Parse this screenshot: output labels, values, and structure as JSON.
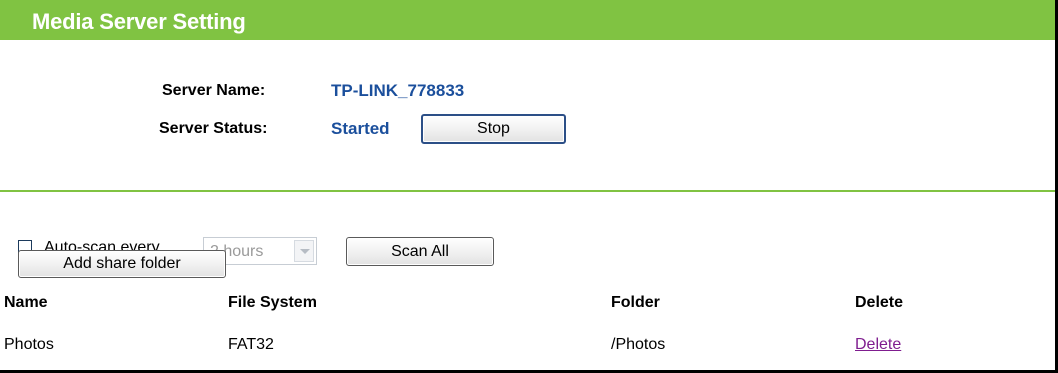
{
  "header": {
    "title": "Media Server Setting"
  },
  "server": {
    "name_label": "Server Name:",
    "name_value": "TP-LINK_778833",
    "status_label": "Server Status:",
    "status_value": "Started",
    "stop_label": "Stop"
  },
  "scan": {
    "auto_scan_checked": false,
    "auto_scan_label": "Auto-scan every",
    "interval_value": "2 hours",
    "scan_all_label": "Scan All",
    "add_folder_label": "Add share folder"
  },
  "table": {
    "columns": [
      "Name",
      "File System",
      "Folder",
      "Delete"
    ],
    "rows": [
      {
        "name": "Photos",
        "file_system": "FAT32",
        "folder": "/Photos",
        "delete": "Delete"
      }
    ]
  },
  "colors": {
    "header_green": "#80c342",
    "value_blue": "#1b4f9c",
    "link_purple": "#7f1d8f"
  }
}
